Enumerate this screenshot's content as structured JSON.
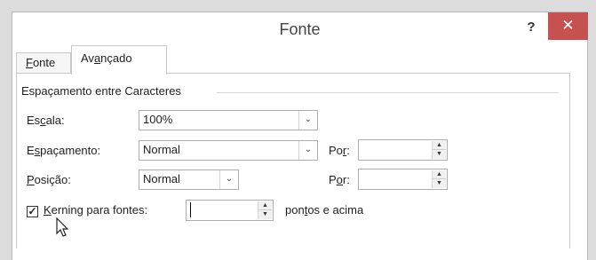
{
  "window": {
    "title": "Fonte"
  },
  "titlebar": {
    "help_label": "?",
    "close_label": "✕"
  },
  "tabs": [
    {
      "pre": "",
      "key": "F",
      "post": "onte"
    },
    {
      "pre": "Av",
      "key": "a",
      "post": "nçado"
    }
  ],
  "section": {
    "title": "Espaçamento entre Caracteres"
  },
  "scale": {
    "pre": "Es",
    "key": "c",
    "post": "ala:",
    "value": "100%"
  },
  "spacing": {
    "pre": "E",
    "key": "s",
    "post": "paçamento:",
    "value": "Normal"
  },
  "position": {
    "pre": "",
    "key": "P",
    "post": "osição:",
    "value": "Normal"
  },
  "by1": {
    "pre": "Po",
    "key": "r",
    "post": ":",
    "value": ""
  },
  "by2": {
    "pre": "P",
    "key": "o",
    "post": "r:",
    "value": ""
  },
  "kerning": {
    "pre": "",
    "key": "K",
    "post": "erning para fontes:",
    "checked": true,
    "value": ""
  },
  "points": {
    "pre": "pon",
    "key": "t",
    "post": "os e acima"
  },
  "icons": {
    "dropdown": "chevron-down-icon",
    "spin_up": "triangle-up-icon",
    "spin_down": "triangle-down-icon",
    "cursor": "mouse-pointer-icon"
  },
  "colors": {
    "close_button": "#c75050",
    "border": "#abadb3"
  }
}
